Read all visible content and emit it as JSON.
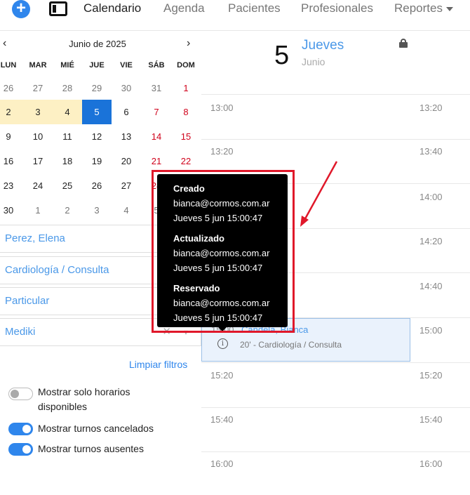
{
  "nav": {
    "items": [
      "Calendario",
      "Agenda",
      "Pacientes",
      "Profesionales",
      "Reportes"
    ]
  },
  "calendar": {
    "title": "Junio de 2025",
    "prev": "‹",
    "next": "›",
    "weekdays": [
      "LUN",
      "MAR",
      "MIÉ",
      "JUE",
      "VIE",
      "SÁB",
      "DOM"
    ],
    "weeks": [
      [
        "26",
        "27",
        "28",
        "29",
        "30",
        "31",
        "1"
      ],
      [
        "2",
        "3",
        "4",
        "5",
        "6",
        "7",
        "8"
      ],
      [
        "9",
        "10",
        "11",
        "12",
        "13",
        "14",
        "15"
      ],
      [
        "16",
        "17",
        "18",
        "19",
        "20",
        "21",
        "22"
      ],
      [
        "23",
        "24",
        "25",
        "26",
        "27",
        "28",
        "29"
      ],
      [
        "30",
        "1",
        "2",
        "3",
        "4",
        "5",
        "6"
      ]
    ]
  },
  "filters": {
    "professional": "Perez, Elena",
    "service": "Cardiología / Consulta",
    "coverage": "Particular",
    "insurer": "Mediki",
    "clear_label": "Limpiar filtros"
  },
  "toggles": [
    {
      "label": "Mostrar solo horarios disponibles",
      "on": false
    },
    {
      "label": "Mostrar turnos cancelados",
      "on": true
    },
    {
      "label": "Mostrar turnos ausentes",
      "on": true
    }
  ],
  "day_header": {
    "number": "5",
    "weekday": "Jueves",
    "month": "Junio"
  },
  "times_left": [
    "13:00",
    "13:20",
    "13:40",
    "14:00",
    "14:20",
    "14:40",
    "15:00",
    "15:20",
    "15:40",
    "16:00"
  ],
  "times_right": [
    "13:20",
    "13:40",
    "14:00",
    "14:20",
    "14:40",
    "15:00",
    "15:20",
    "15:40",
    "16:00"
  ],
  "appointment": {
    "time": "15:00",
    "patient": "Candela, Bianca",
    "description": "20' - Cardiología / Consulta"
  },
  "tooltip": {
    "sections": [
      {
        "heading": "Creado",
        "email": "bianca@cormos.com.ar",
        "date": "Jueves 5 jun 15:00:47"
      },
      {
        "heading": "Actualizado",
        "email": "bianca@cormos.com.ar",
        "date": "Jueves 5 jun 15:00:47"
      },
      {
        "heading": "Reservado",
        "email": "bianca@cormos.com.ar",
        "date": "Jueves 5 jun 15:00:47"
      }
    ]
  },
  "colors": {
    "accent": "#2f86ec",
    "link": "#4a98e8",
    "selected_day": "#1a73d9",
    "highlight_day": "#fdf0c4",
    "weekend": "#d0021b",
    "annotation": "#e0182a"
  }
}
